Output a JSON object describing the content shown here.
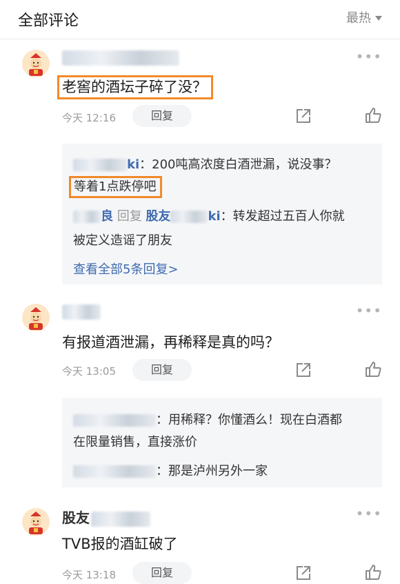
{
  "header": {
    "title": "全部评论",
    "sort_label": "最热"
  },
  "comments": [
    {
      "username_visible": "",
      "text": "老窖的酒坛子碎了没？",
      "time": "今天 12:16",
      "reply_label": "回复",
      "replies": [
        {
          "name_tail": "ki",
          "text": "：200吨高浓度白酒泄漏，说没事？",
          "text2": "等着1点跌停吧"
        },
        {
          "name_a": "良",
          "reply_word": "回复",
          "name_b": "股友",
          "name_b_tail": "ki",
          "text": "：转发超过五百人你就",
          "text2": "被定义造谣了朋友"
        }
      ],
      "view_all": "查看全部5条回复>"
    },
    {
      "username_visible": "",
      "text": "有报道酒泄漏，再稀释是真的吗？",
      "time": "今天 13:05",
      "reply_label": "回复",
      "replies": [
        {
          "text": "：用稀释？你懂酒么！现在白酒都",
          "text2": "在限量销售，直接涨价"
        },
        {
          "text": "：那是泸州另外一家"
        }
      ]
    },
    {
      "username_visible": "股友",
      "text": "TVB报的酒缸破了",
      "time": "今天 13:18",
      "reply_label": "回复"
    }
  ],
  "more_glyph": "•••",
  "colors": {
    "highlight": "#f08a2a",
    "link": "#3f6bb0"
  }
}
